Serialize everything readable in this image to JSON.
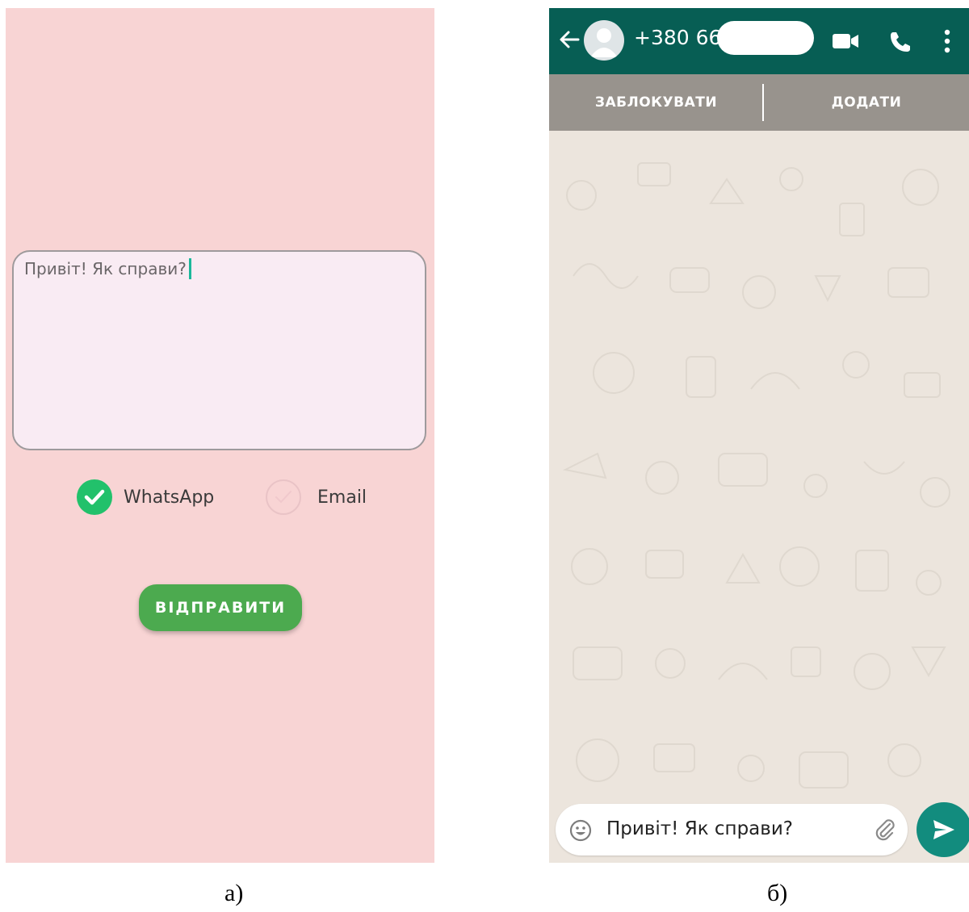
{
  "panel_a": {
    "background_color": "#f8d4d4",
    "message_text": "Привіт! Як справи?",
    "options": [
      {
        "label": "WhatsApp",
        "checked": true
      },
      {
        "label": "Email",
        "checked": false
      }
    ],
    "check_on_color": "#22c16b",
    "send_button_label": "ВІДПРАВИТИ",
    "send_button_color": "#4caa4f"
  },
  "panel_b": {
    "contact_number": "+380 66",
    "header_color": "#075e54",
    "icons": [
      "back-arrow-icon",
      "avatar-icon",
      "video-call-icon",
      "phone-call-icon",
      "more-vert-icon",
      "emoji-icon",
      "attach-icon",
      "send-icon"
    ],
    "actions": {
      "block_label": "ЗАБЛОКУВАТИ",
      "add_label": "ДОДАТИ"
    },
    "input_text": "Привіт! Як справи?",
    "send_button_color": "#128c7e"
  },
  "captions": {
    "a": "а)",
    "b": "б)"
  }
}
